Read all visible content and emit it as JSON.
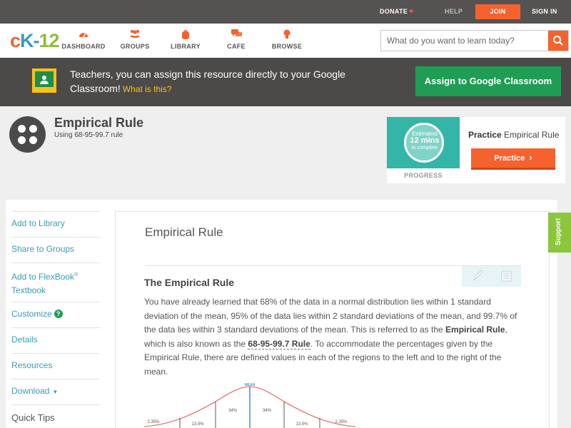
{
  "topbar": {
    "donate": "DONATE",
    "help": "HELP",
    "join": "JOIN",
    "signin": "SIGN IN"
  },
  "nav": {
    "logo": {
      "c": "c",
      "k": "K-",
      "n": "12"
    },
    "items": [
      {
        "label": "DASHBOARD",
        "icon": "gauge-icon"
      },
      {
        "label": "GROUPS",
        "icon": "people-icon"
      },
      {
        "label": "LIBRARY",
        "icon": "backpack-icon"
      },
      {
        "label": "CAFE",
        "icon": "chat-icon"
      },
      {
        "label": "BROWSE",
        "icon": "lightbulb-icon"
      }
    ],
    "search_placeholder": "What do you want to learn today?"
  },
  "banner": {
    "text": "Teachers, you can assign this resource directly to your Google Classroom!",
    "what_is_this": "What is this?",
    "button": "Assign to Google Classroom"
  },
  "concept": {
    "title": "Empirical Rule",
    "subtitle": "Using 68-95-99.7 rule"
  },
  "practice": {
    "thumb_line1": "Estimated",
    "thumb_line2": "12 mins",
    "thumb_line3": "to complete",
    "progress": "PROGRESS",
    "heading_bold": "Practice",
    "heading_rest": "Empirical Rule",
    "button": "Practice"
  },
  "sidebar": {
    "add_library": "Add to Library",
    "share_groups": "Share to Groups",
    "flexbook_line1": "Add to FlexBook",
    "flexbook_reg": "®",
    "flexbook_line2": "Textbook",
    "customize": "Customize",
    "customize_badge": "?",
    "details": "Details",
    "resources": "Resources",
    "download": "Download",
    "quick_tips": "Quick Tips"
  },
  "article": {
    "title": "Empirical Rule",
    "section_title": "The Empirical Rule",
    "p1": "You have already learned that 68% of the data in a normal distribution lies within 1 standard deviation of the mean, 95% of the data lies within 2 standard deviations of the mean, and 99.7% of the data lies within 3 standard deviations of the mean. This is referred to as the ",
    "kw1": "Empirical Rule",
    "p2": ", which is also known as the ",
    "kw2": "68-95-99.7 Rule",
    "p3": ". To accommodate the percentages given by the Empirical Rule, there are defined values in each of the regions to the left and to the right of the mean."
  },
  "chart_labels": {
    "mean": "MEAN",
    "left_34": "34%",
    "right_34": "34%",
    "left_135": "13.5%",
    "right_135": "13.5%",
    "left_235": "2.35%",
    "right_235": "2.35%"
  },
  "support": "Support",
  "colors": {
    "accent": "#f5622e",
    "link": "#3b9bb3",
    "google_green": "#1f9d55",
    "support_green": "#8cc63f"
  }
}
